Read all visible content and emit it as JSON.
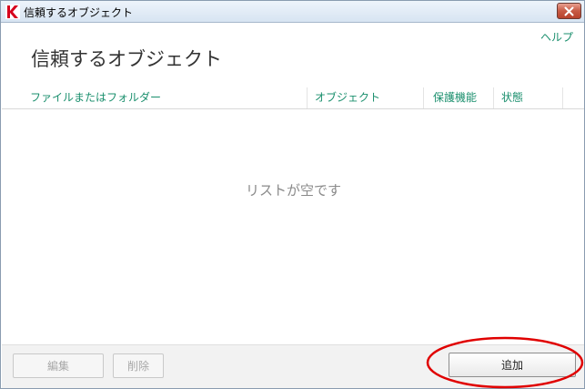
{
  "window": {
    "title": "信頼するオブジェクト",
    "close_label": "×"
  },
  "header": {
    "help": "ヘルプ",
    "page_title": "信頼するオブジェクト"
  },
  "table": {
    "columns": [
      "ファイルまたはフォルダー",
      "オブジェクト",
      "保護機能",
      "状態"
    ],
    "empty_message": "リストが空です"
  },
  "footer": {
    "edit_label": "編集",
    "delete_label": "削除",
    "add_label": "追加"
  },
  "colors": {
    "accent": "#1a8f6d",
    "highlight": "#e00000"
  },
  "icons": {
    "app": "kaspersky-logo-icon",
    "close": "close-icon"
  }
}
